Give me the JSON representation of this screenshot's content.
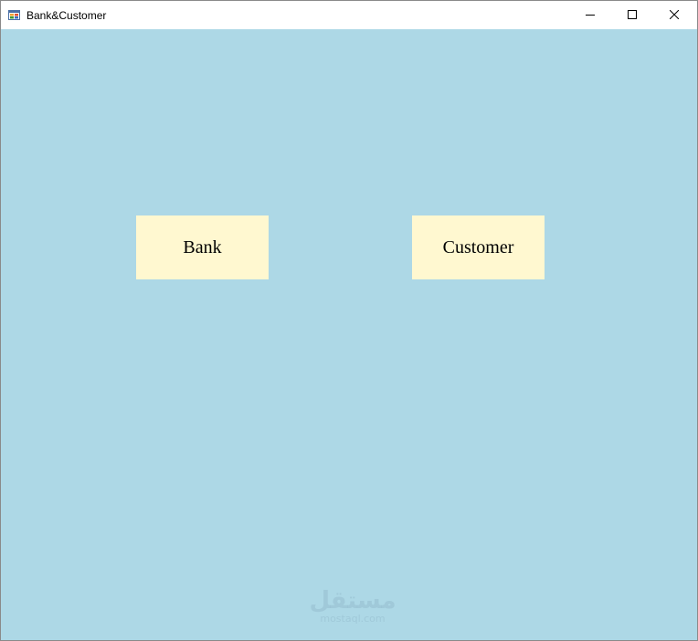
{
  "window": {
    "title": "Bank&Customer"
  },
  "colors": {
    "client_background": "#add8e6",
    "button_background": "#fff8d0",
    "titlebar_background": "#ffffff"
  },
  "buttons": {
    "bank_label": "Bank",
    "customer_label": "Customer"
  },
  "watermark": {
    "main": "مستقل",
    "sub": "mostaql.com"
  },
  "icons": {
    "app": "form-app-icon",
    "minimize": "minimize-icon",
    "maximize": "maximize-icon",
    "close": "close-icon"
  }
}
